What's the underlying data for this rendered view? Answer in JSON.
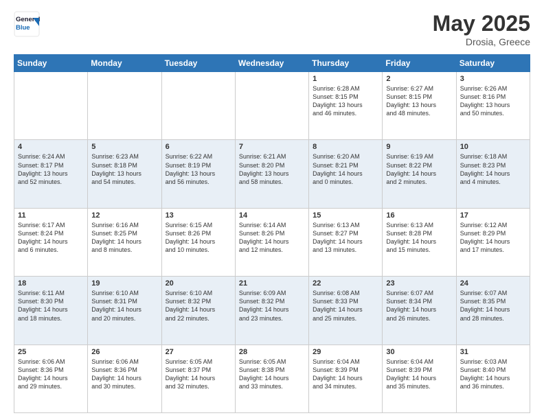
{
  "logo": {
    "line1": "General",
    "line2": "Blue"
  },
  "header": {
    "month": "May 2025",
    "location": "Drosia, Greece"
  },
  "weekdays": [
    "Sunday",
    "Monday",
    "Tuesday",
    "Wednesday",
    "Thursday",
    "Friday",
    "Saturday"
  ],
  "weeks": [
    [
      {
        "day": "",
        "info": ""
      },
      {
        "day": "",
        "info": ""
      },
      {
        "day": "",
        "info": ""
      },
      {
        "day": "",
        "info": ""
      },
      {
        "day": "1",
        "info": "Sunrise: 6:28 AM\nSunset: 8:15 PM\nDaylight: 13 hours\nand 46 minutes."
      },
      {
        "day": "2",
        "info": "Sunrise: 6:27 AM\nSunset: 8:15 PM\nDaylight: 13 hours\nand 48 minutes."
      },
      {
        "day": "3",
        "info": "Sunrise: 6:26 AM\nSunset: 8:16 PM\nDaylight: 13 hours\nand 50 minutes."
      }
    ],
    [
      {
        "day": "4",
        "info": "Sunrise: 6:24 AM\nSunset: 8:17 PM\nDaylight: 13 hours\nand 52 minutes."
      },
      {
        "day": "5",
        "info": "Sunrise: 6:23 AM\nSunset: 8:18 PM\nDaylight: 13 hours\nand 54 minutes."
      },
      {
        "day": "6",
        "info": "Sunrise: 6:22 AM\nSunset: 8:19 PM\nDaylight: 13 hours\nand 56 minutes."
      },
      {
        "day": "7",
        "info": "Sunrise: 6:21 AM\nSunset: 8:20 PM\nDaylight: 13 hours\nand 58 minutes."
      },
      {
        "day": "8",
        "info": "Sunrise: 6:20 AM\nSunset: 8:21 PM\nDaylight: 14 hours\nand 0 minutes."
      },
      {
        "day": "9",
        "info": "Sunrise: 6:19 AM\nSunset: 8:22 PM\nDaylight: 14 hours\nand 2 minutes."
      },
      {
        "day": "10",
        "info": "Sunrise: 6:18 AM\nSunset: 8:23 PM\nDaylight: 14 hours\nand 4 minutes."
      }
    ],
    [
      {
        "day": "11",
        "info": "Sunrise: 6:17 AM\nSunset: 8:24 PM\nDaylight: 14 hours\nand 6 minutes."
      },
      {
        "day": "12",
        "info": "Sunrise: 6:16 AM\nSunset: 8:25 PM\nDaylight: 14 hours\nand 8 minutes."
      },
      {
        "day": "13",
        "info": "Sunrise: 6:15 AM\nSunset: 8:26 PM\nDaylight: 14 hours\nand 10 minutes."
      },
      {
        "day": "14",
        "info": "Sunrise: 6:14 AM\nSunset: 8:26 PM\nDaylight: 14 hours\nand 12 minutes."
      },
      {
        "day": "15",
        "info": "Sunrise: 6:13 AM\nSunset: 8:27 PM\nDaylight: 14 hours\nand 13 minutes."
      },
      {
        "day": "16",
        "info": "Sunrise: 6:13 AM\nSunset: 8:28 PM\nDaylight: 14 hours\nand 15 minutes."
      },
      {
        "day": "17",
        "info": "Sunrise: 6:12 AM\nSunset: 8:29 PM\nDaylight: 14 hours\nand 17 minutes."
      }
    ],
    [
      {
        "day": "18",
        "info": "Sunrise: 6:11 AM\nSunset: 8:30 PM\nDaylight: 14 hours\nand 18 minutes."
      },
      {
        "day": "19",
        "info": "Sunrise: 6:10 AM\nSunset: 8:31 PM\nDaylight: 14 hours\nand 20 minutes."
      },
      {
        "day": "20",
        "info": "Sunrise: 6:10 AM\nSunset: 8:32 PM\nDaylight: 14 hours\nand 22 minutes."
      },
      {
        "day": "21",
        "info": "Sunrise: 6:09 AM\nSunset: 8:32 PM\nDaylight: 14 hours\nand 23 minutes."
      },
      {
        "day": "22",
        "info": "Sunrise: 6:08 AM\nSunset: 8:33 PM\nDaylight: 14 hours\nand 25 minutes."
      },
      {
        "day": "23",
        "info": "Sunrise: 6:07 AM\nSunset: 8:34 PM\nDaylight: 14 hours\nand 26 minutes."
      },
      {
        "day": "24",
        "info": "Sunrise: 6:07 AM\nSunset: 8:35 PM\nDaylight: 14 hours\nand 28 minutes."
      }
    ],
    [
      {
        "day": "25",
        "info": "Sunrise: 6:06 AM\nSunset: 8:36 PM\nDaylight: 14 hours\nand 29 minutes."
      },
      {
        "day": "26",
        "info": "Sunrise: 6:06 AM\nSunset: 8:36 PM\nDaylight: 14 hours\nand 30 minutes."
      },
      {
        "day": "27",
        "info": "Sunrise: 6:05 AM\nSunset: 8:37 PM\nDaylight: 14 hours\nand 32 minutes."
      },
      {
        "day": "28",
        "info": "Sunrise: 6:05 AM\nSunset: 8:38 PM\nDaylight: 14 hours\nand 33 minutes."
      },
      {
        "day": "29",
        "info": "Sunrise: 6:04 AM\nSunset: 8:39 PM\nDaylight: 14 hours\nand 34 minutes."
      },
      {
        "day": "30",
        "info": "Sunrise: 6:04 AM\nSunset: 8:39 PM\nDaylight: 14 hours\nand 35 minutes."
      },
      {
        "day": "31",
        "info": "Sunrise: 6:03 AM\nSunset: 8:40 PM\nDaylight: 14 hours\nand 36 minutes."
      }
    ]
  ]
}
